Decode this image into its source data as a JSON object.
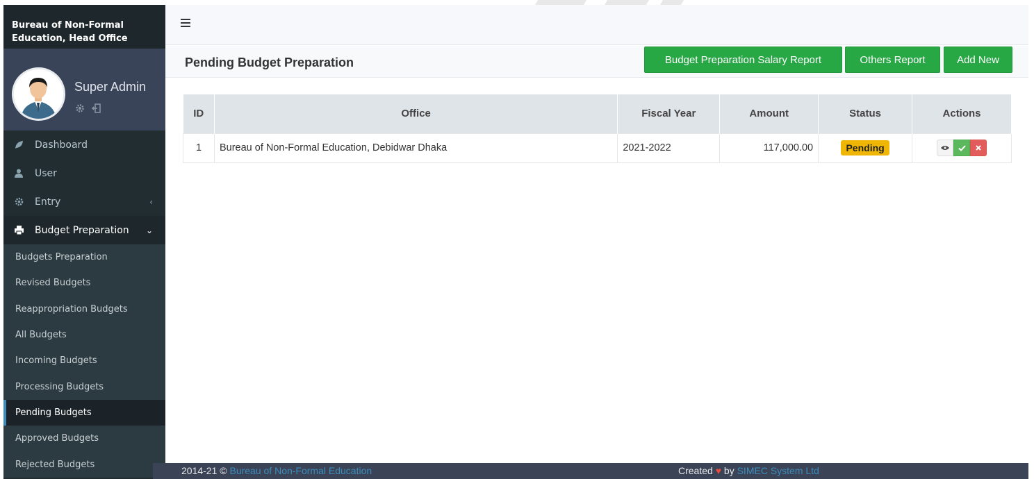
{
  "brand": {
    "line1": "Bureau of Non-Formal",
    "line2": "Education, Head Office"
  },
  "user": {
    "name": "Super Admin"
  },
  "sidebar": {
    "items": [
      {
        "label": "Dashboard",
        "icon": "leaf-icon"
      },
      {
        "label": "User",
        "icon": "user-icon"
      },
      {
        "label": "Entry",
        "icon": "gear-icon",
        "caret": "‹"
      },
      {
        "label": "Budget Preparation",
        "icon": "printer-icon",
        "caret": "⌄"
      }
    ],
    "submenu": [
      {
        "label": "Budgets Preparation"
      },
      {
        "label": "Revised Budgets"
      },
      {
        "label": "Reappropriation Budgets"
      },
      {
        "label": "All Budgets"
      },
      {
        "label": "Incoming Budgets"
      },
      {
        "label": "Processing Budgets"
      },
      {
        "label": "Pending Budgets"
      },
      {
        "label": "Approved Budgets"
      },
      {
        "label": "Rejected Budgets"
      }
    ]
  },
  "header": {
    "title": "Pending Budget Preparation",
    "buttons": {
      "salary_report": "Budget Preparation Salary Report",
      "others_report": "Others Report",
      "add_new": "Add New"
    }
  },
  "table": {
    "columns": [
      "ID",
      "Office",
      "Fiscal Year",
      "Amount",
      "Status",
      "Actions"
    ],
    "rows": [
      {
        "id": "1",
        "office": "Bureau of Non-Formal Education, Debidwar Dhaka",
        "fiscal_year": "2021-2022",
        "amount": "117,000.00",
        "status": "Pending"
      }
    ]
  },
  "footer": {
    "copyright": "2014-21 ©",
    "org_link": "Bureau of Non-Formal Education",
    "created": "Created",
    "by": "by",
    "company_link": "SIMEC System Ltd"
  },
  "colors": {
    "sidebar_bg": "#222d32",
    "primary_button": "#28a745",
    "pending_badge": "#f0b605",
    "link": "#3c8dbc"
  }
}
